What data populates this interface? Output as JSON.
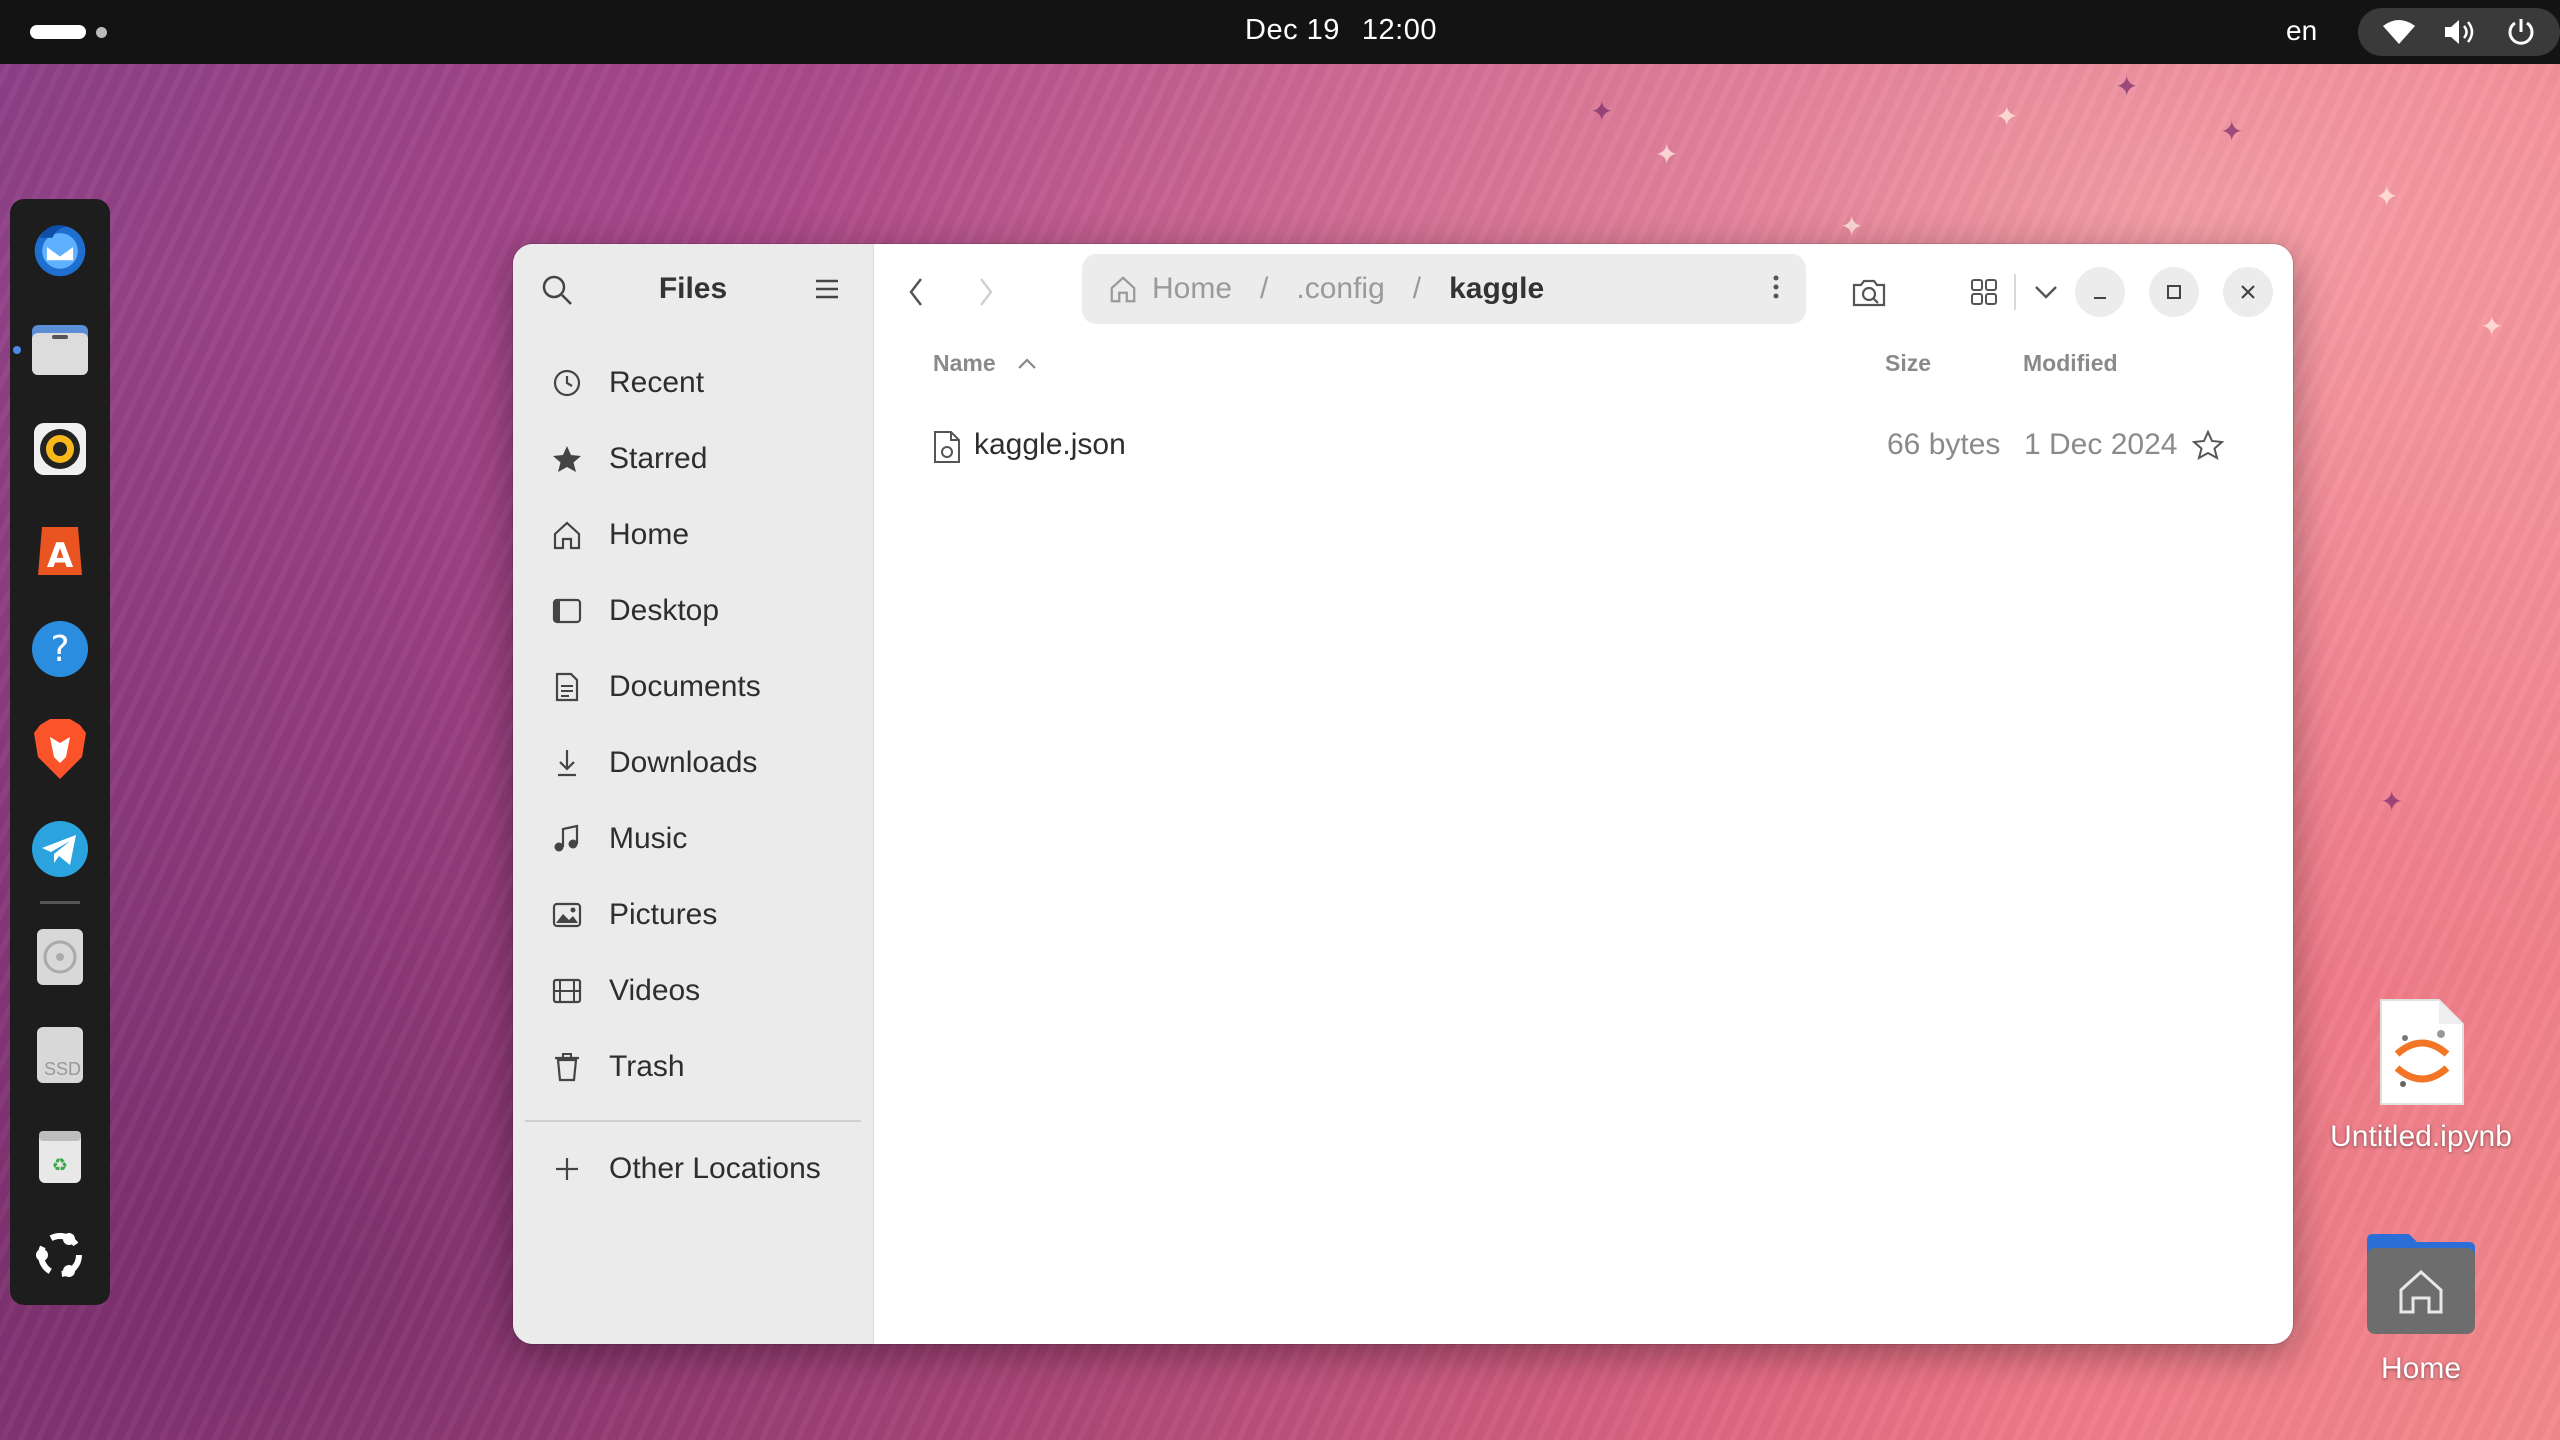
{
  "topbar": {
    "date": "Dec 19",
    "time": "12:00",
    "language": "en"
  },
  "dock": {
    "apps": [
      {
        "name": "Thunderbird",
        "icon": "thunderbird-icon"
      },
      {
        "name": "Files",
        "icon": "files-icon",
        "running": true
      },
      {
        "name": "Rhythmbox",
        "icon": "rhythmbox-icon"
      },
      {
        "name": "App Center",
        "icon": "app-center-icon"
      },
      {
        "name": "Help",
        "icon": "help-icon"
      },
      {
        "name": "Brave",
        "icon": "brave-icon"
      },
      {
        "name": "Telegram",
        "icon": "telegram-icon"
      },
      {
        "name": "Optical Drive",
        "icon": "disc-icon"
      },
      {
        "name": "SSD",
        "icon": "ssd-icon",
        "label": "SSD"
      },
      {
        "name": "Trash",
        "icon": "trash-icon"
      },
      {
        "name": "Show Apps",
        "icon": "ubuntu-icon"
      }
    ]
  },
  "window": {
    "sidebar": {
      "title": "Files",
      "items": [
        {
          "label": "Recent",
          "icon": "clock-icon"
        },
        {
          "label": "Starred",
          "icon": "star-icon"
        },
        {
          "label": "Home",
          "icon": "home-icon"
        },
        {
          "label": "Desktop",
          "icon": "desktop-icon"
        },
        {
          "label": "Documents",
          "icon": "document-icon"
        },
        {
          "label": "Downloads",
          "icon": "download-icon"
        },
        {
          "label": "Music",
          "icon": "music-icon"
        },
        {
          "label": "Pictures",
          "icon": "picture-icon"
        },
        {
          "label": "Videos",
          "icon": "video-icon"
        },
        {
          "label": "Trash",
          "icon": "trash-icon"
        }
      ],
      "other_locations": "Other Locations"
    },
    "path": {
      "crumbs": [
        "Home",
        ".config",
        "kaggle"
      ],
      "separator": "/"
    },
    "columns": {
      "name": "Name",
      "size": "Size",
      "modified": "Modified"
    },
    "files": [
      {
        "name": "kaggle.json",
        "size": "66 bytes",
        "modified": "1 Dec 2024",
        "starred": false
      }
    ]
  },
  "desktop": {
    "icons": [
      {
        "label": "Untitled.ipynb",
        "icon": "notebook-file-icon"
      },
      {
        "label": "Home",
        "icon": "home-folder-icon"
      }
    ]
  },
  "colors": {
    "topbar": "#131313",
    "dock": "#1d1d1d",
    "sidebar": "#ebebeb",
    "accent": "#e95420"
  }
}
